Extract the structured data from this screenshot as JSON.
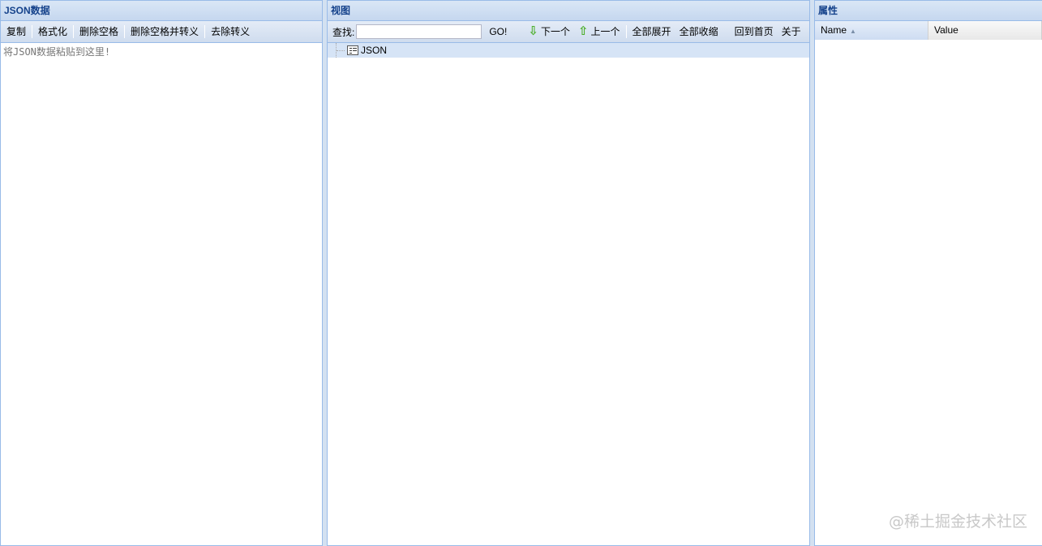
{
  "left_panel": {
    "title": "JSON数据",
    "toolbar": [
      "复制",
      "格式化",
      "删除空格",
      "删除空格并转义",
      "去除转义"
    ],
    "placeholder": "将JSON数据粘贴到这里!"
  },
  "center_panel": {
    "title": "视图",
    "search_label": "查找:",
    "search_value": "",
    "go_label": "GO!",
    "next_label": "下一个",
    "prev_label": "上一个",
    "expand_all_label": "全部展开",
    "collapse_all_label": "全部收缩",
    "home_label": "回到首页",
    "about_label": "关于",
    "tree_root": "JSON",
    "arrow_color": "#4caf2a"
  },
  "right_panel": {
    "title": "属性",
    "columns": {
      "name": "Name",
      "value": "Value"
    }
  },
  "watermark": "@稀土掘金技术社区"
}
